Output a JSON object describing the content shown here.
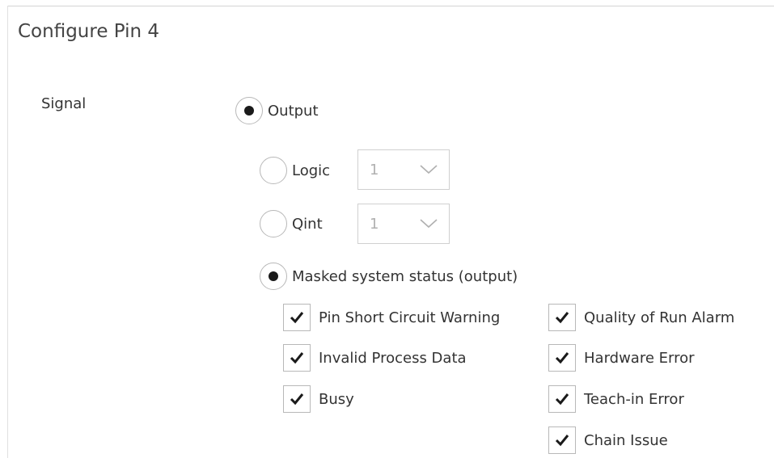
{
  "panel": {
    "title": "Configure Pin 4"
  },
  "signal": {
    "label": "Signal",
    "output": {
      "label": "Output",
      "selected": true
    },
    "logic": {
      "label": "Logic",
      "selected": false,
      "value": "1"
    },
    "qint": {
      "label": "Qint",
      "selected": false,
      "value": "1"
    },
    "masked": {
      "label": "Masked system status (output)",
      "selected": true
    }
  },
  "status_flags": {
    "left": [
      {
        "label": "Pin Short Circuit Warning",
        "checked": true
      },
      {
        "label": "Invalid Process Data",
        "checked": true
      },
      {
        "label": "Busy",
        "checked": true
      }
    ],
    "right": [
      {
        "label": "Quality of Run Alarm",
        "checked": true
      },
      {
        "label": "Hardware Error",
        "checked": true
      },
      {
        "label": "Teach-in Error",
        "checked": true
      },
      {
        "label": "Chain Issue",
        "checked": true
      }
    ]
  }
}
